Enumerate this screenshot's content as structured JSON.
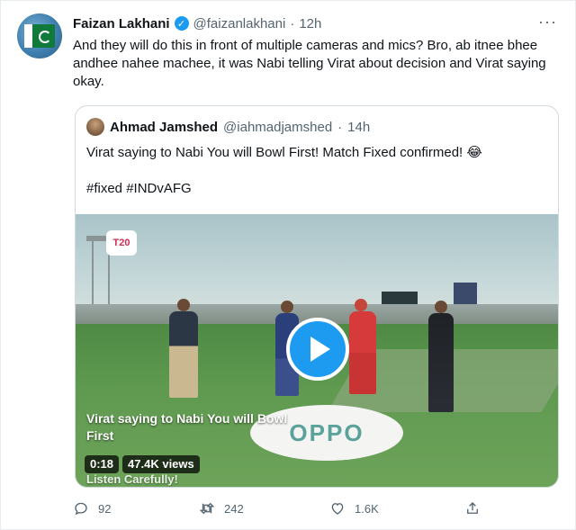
{
  "tweet": {
    "author_name": "Faizan Lakhani",
    "verified_mark": "✓",
    "handle": "@faizanlakhani",
    "separator": "·",
    "time": "12h",
    "more_label": "···",
    "text": "And they will do this in front of multiple cameras and mics? Bro, ab itnee bhee andhee nahee machee, it was Nabi telling Virat about decision and Virat saying okay."
  },
  "quote": {
    "author_name": "Ahmad Jamshed",
    "handle": "@iahmadjamshed",
    "separator": "·",
    "time": "14h",
    "text_line1": "Virat saying to Nabi You will Bowl First! Match Fixed confirmed! 😂",
    "text_line2": "#fixed #INDvAFG"
  },
  "video": {
    "logo_text": "T20",
    "sponsor_text": "OPPO",
    "caption": "Virat saying to Nabi You will Bowl First",
    "caption_sub": "Listen Carefully!",
    "duration": "0:18",
    "views": "47.4K views"
  },
  "actions": {
    "reply_count": "92",
    "retweet_count": "242",
    "like_count": "1.6K",
    "icons": [
      "reply-icon",
      "retweet-icon",
      "like-icon",
      "share-icon"
    ]
  },
  "colors": {
    "accent": "#1d9bf0",
    "muted": "#536471",
    "border": "#cfd9de"
  }
}
